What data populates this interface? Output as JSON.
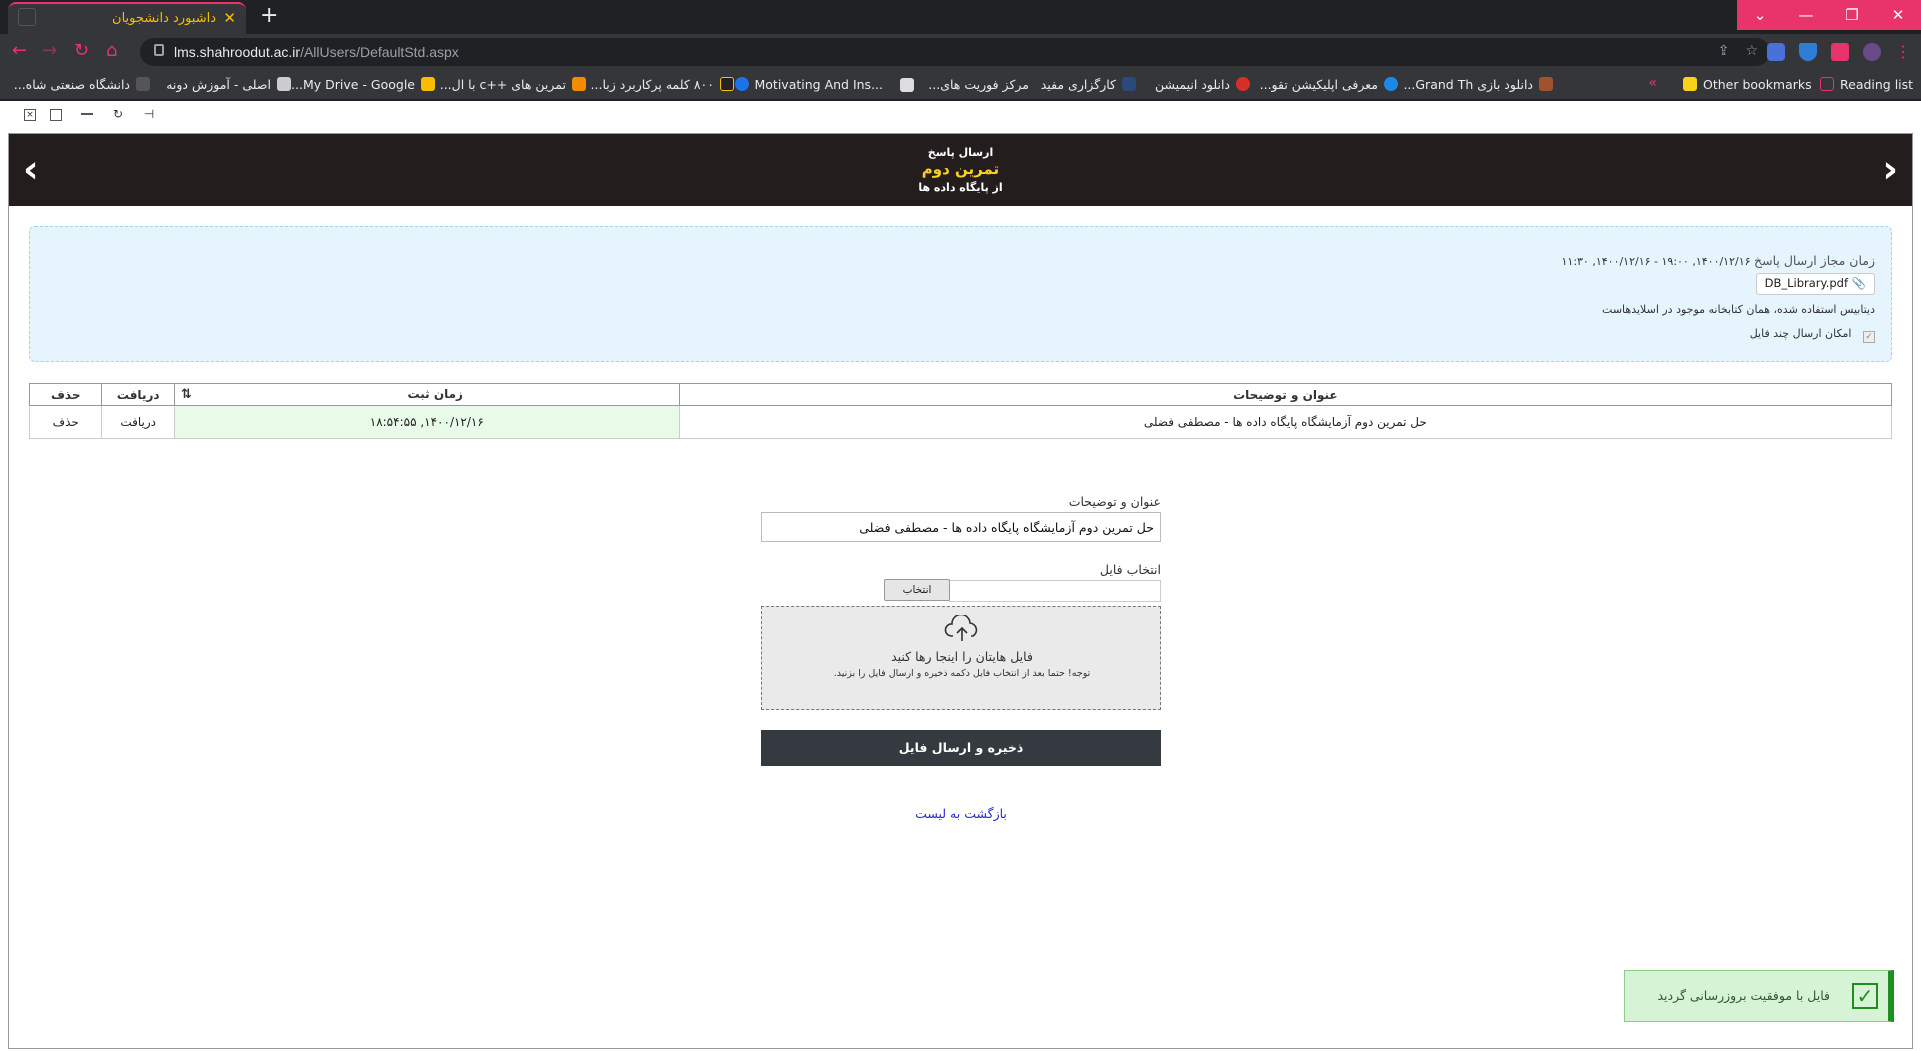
{
  "browser": {
    "tab_title": "داشبورد دانشجویان",
    "tab_close": "✕",
    "new_tab": "+",
    "url_domain": "lms.shahroodut.ac.ir",
    "url_path": "/AllUsers/DefaultStd.aspx",
    "window_buttons": [
      "⌄",
      "—",
      "❐",
      "✕"
    ],
    "bookmarks": [
      {
        "label": "دانشگاه صنعتی شاه...",
        "color": "#555555"
      },
      {
        "label": "اصلی - آموزش دونه",
        "color": "#cccccc"
      },
      {
        "label": "My Drive - Google...",
        "color": "#fbbc04"
      },
      {
        "label": "تمرین های ++c با ال...",
        "color": "#f28b00"
      },
      {
        "label": "۸۰۰ کلمه پرکاربرد زبا...",
        "color": "#222222"
      },
      {
        "label": "Motivating And Ins...",
        "color": "#1a73e8"
      },
      {
        "label": "مرکز فوریت های...",
        "color": "#dddddd"
      },
      {
        "label": "کارگزاری مفید",
        "color": "#2b4a7a"
      },
      {
        "label": "دانلود انیمیشن",
        "color": "#d93025"
      },
      {
        "label": "معرفی اپلیکیشن تقو...",
        "color": "#1e88e5"
      },
      {
        "label": "دانلود بازی Grand Th...",
        "color": "#a0522d"
      }
    ],
    "bookmarks_more": "»",
    "other_bookmarks": "Other bookmarks",
    "reading_list": "Reading list"
  },
  "header": {
    "line1": "ارسال پاسخ",
    "line2": "تمرین دوم",
    "line3": "از پایگاه داده ها",
    "prev_arrow": "‹",
    "next_arrow": "›"
  },
  "info": {
    "time_label": "زمان مجاز ارسال پاسخ",
    "time_value": "۱۴۰۰/۱۲/۱۶, ۱۹:۰۰ - ۱۴۰۰/۱۲/۱۶, ۱۱:۳۰",
    "attachment": "DB_Library.pdf",
    "description": "دیتابیس استفاده شده، همان کتابخانه موجود در اسلایدهاست",
    "multi_file_label": "امکان ارسال چند فایل"
  },
  "table": {
    "headers": {
      "title": "عنوان و توضیحات",
      "time": "زمان ثبت",
      "download": "دریافت",
      "delete": "حذف"
    },
    "rows": [
      {
        "title": "حل تمرین دوم آزمایشگاه پایگاه داده ها - مصطفی فضلی",
        "time": "۱۴۰۰/۱۲/۱۶, ۱۸:۵۴:۵۵",
        "download": "دریافت",
        "delete": "حذف"
      }
    ]
  },
  "form": {
    "title_label": "عنوان و توضیحات",
    "title_value": "حل تمرین دوم آزمایشگاه پایگاه داده ها - مصطفی فضلی",
    "file_label": "انتخاب فایل",
    "choose_button": "انتخاب",
    "dropzone_title": "فایل هایتان را اینجا رها کنید",
    "dropzone_note": "توجه! حتما بعد از انتخاب فایل دکمه ذخیره و ارسال فایل را بزنید.",
    "submit_label": "ذخیره و ارسال فایل",
    "back_link": "بازگشت به لیست"
  },
  "toast": {
    "message": "فایل با موفقیت بروزرسانی گردید",
    "icon": "✓"
  },
  "colors": {
    "accent": "#e8336b",
    "header_bg": "#231d1d",
    "header_highlight": "#fbd21a",
    "info_bg": "#e6f5fd",
    "submit_bg": "#343a40",
    "toast_bg": "#d6f3d6",
    "toast_accent": "#1e8e1e"
  }
}
